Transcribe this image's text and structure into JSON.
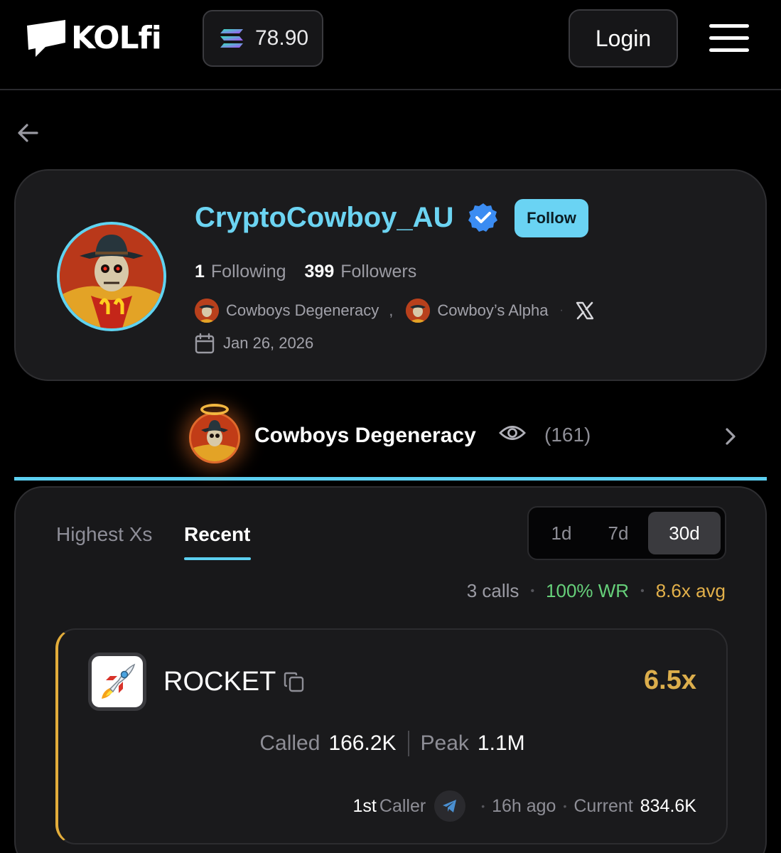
{
  "header": {
    "brand": "KOLfi",
    "sol_price": "78.90",
    "login_label": "Login"
  },
  "profile": {
    "username": "CryptoCowboy_AU",
    "follow_label": "Follow",
    "following_count": "1",
    "following_label": "Following",
    "followers_count": "399",
    "followers_label": "Followers",
    "groups": [
      "Cowboys Degeneracy",
      "Cowboy’s Alpha"
    ],
    "comma": ",",
    "joined": "Jan 26, 2026"
  },
  "group_row": {
    "name": "Cowboys Degeneracy",
    "viewers": "(161)"
  },
  "calls": {
    "tabs": [
      "Highest Xs",
      "Recent"
    ],
    "ranges": [
      "1d",
      "7d",
      "30d"
    ],
    "summary": {
      "calls": "3 calls",
      "win_rate": "100% WR",
      "avg": "8.6x avg"
    },
    "card": {
      "token": "ROCKET",
      "multiplier": "6.5x",
      "called_label": "Called",
      "called_value": "166.2K",
      "peak_label": "Peak",
      "peak_value": "1.1M",
      "rank": "1st",
      "caller_label": "Caller",
      "time": "16h ago",
      "current_label": "Current",
      "current_value": "834.6K"
    }
  },
  "colors": {
    "accent": "#5ccff0",
    "gold": "#dcae4c",
    "green": "#66d07a"
  }
}
